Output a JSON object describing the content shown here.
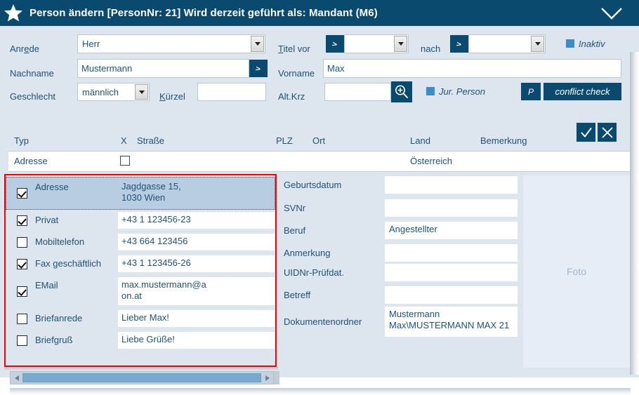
{
  "titlebar": {
    "icon": "star-icon",
    "title": "Person ändern  [PersonNr: 21] Wird derzeit geführt als: Mandant (M6)",
    "collapse_icon": "chevron-down-icon",
    "bg": "#0b4a6f"
  },
  "form": {
    "anrede_label": "Anrede",
    "anrede_value": "Herr",
    "titel_vor_label": "Titel vor",
    "titel_vor_btn": ">",
    "titel_vor_value": "",
    "nach_label": "nach",
    "nach_btn": ">",
    "nach_value": "",
    "inaktiv_label": "Inaktiv",
    "nachname_label": "Nachname",
    "nachname_value": "Mustermann",
    "nachname_btn": ">",
    "vorname_label": "Vorname",
    "vorname_value": "Max",
    "geschlecht_label": "Geschlecht",
    "geschlecht_value": "männlich",
    "kuerzel_label": "Kürzel",
    "kuerzel_value": "",
    "altkrz_label": "Alt.Krz",
    "altkrz_value": "",
    "search_icon": "magnifier-plus-icon",
    "jur_person_label": "Jur. Person",
    "p_button": "P",
    "conflict_check_button": "conflict check"
  },
  "grid": {
    "headers": {
      "typ": "Typ",
      "x": "X",
      "strasse": "Straße",
      "plz": "PLZ",
      "ort": "Ort",
      "land": "Land",
      "bemerkung": "Bemerkung"
    },
    "row": {
      "typ": "Adresse",
      "x_checked": false,
      "strasse": "",
      "plz": "",
      "ort": "",
      "land": "Österreich",
      "bemerkung": ""
    },
    "accept_icon": "check-icon",
    "cancel_icon": "close-icon"
  },
  "contact_list": {
    "highlight_color": "#f50000",
    "items": [
      {
        "checked": true,
        "type": "Adresse",
        "value": "Jagdgasse 15,\n1030 Wien",
        "selected": true
      },
      {
        "checked": true,
        "type": "Privat",
        "value": "+43 1 123456-23",
        "selected": false
      },
      {
        "checked": false,
        "type": "Mobiltelefon",
        "value": "+43 664 123456",
        "selected": false
      },
      {
        "checked": true,
        "type": "Fax geschäftlich",
        "value": "+43 1 123456-26",
        "selected": false
      },
      {
        "checked": true,
        "type": "EMail",
        "value": "max.mustermann@a\non.at",
        "selected": false
      },
      {
        "checked": false,
        "type": "Briefanrede",
        "value": "Lieber Max!",
        "selected": false
      },
      {
        "checked": false,
        "type": "Briefgruß",
        "value": "Liebe Grüße!",
        "selected": false
      }
    ]
  },
  "details": {
    "fields": [
      {
        "label": "Geburtsdatum",
        "value": ""
      },
      {
        "label": "SVNr",
        "value": ""
      },
      {
        "label": "Beruf",
        "value": "Angestellter"
      },
      {
        "label": "Anmerkung",
        "value": ""
      },
      {
        "label": "UIDNr-Prüfdat.",
        "value": ""
      },
      {
        "label": "Betreff",
        "value": ""
      },
      {
        "label": "Dokumentenordner",
        "value": "Mustermann\nMax\\MUSTERMANN MAX 21"
      }
    ],
    "photo_placeholder": "Foto"
  },
  "scrollbar": {
    "left_icon": "triangle-left-icon",
    "right_icon": "triangle-right-icon"
  }
}
